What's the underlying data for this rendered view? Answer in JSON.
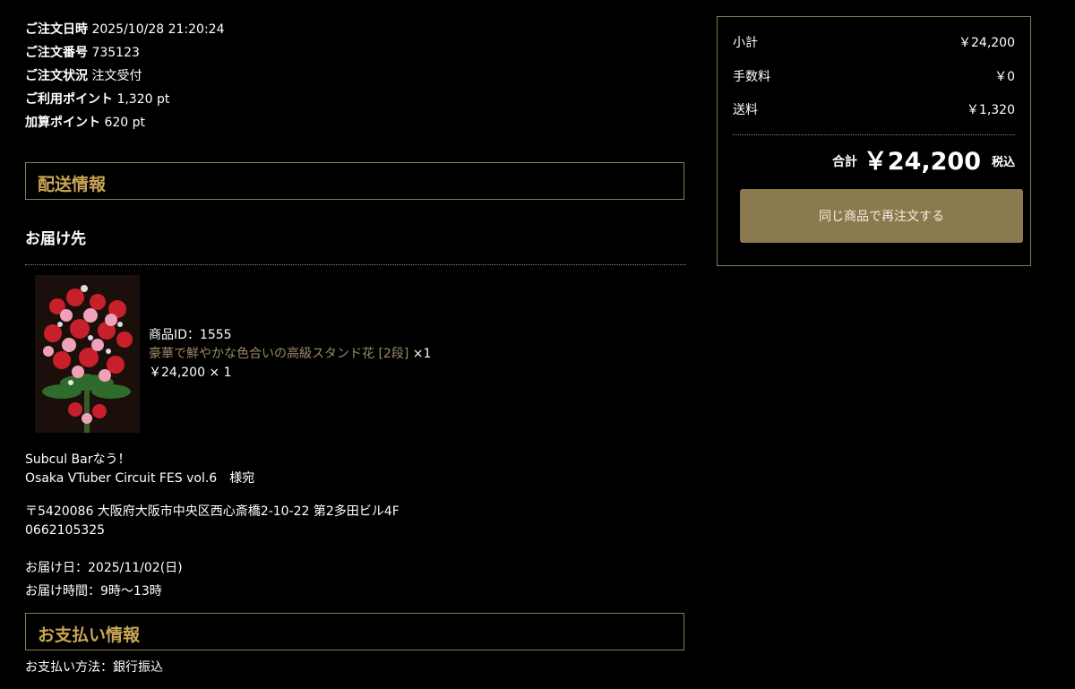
{
  "order": {
    "date_label": "ご注文日時",
    "date_value": "2025/10/28 21:20:24",
    "number_label": "ご注文番号",
    "number_value": "735123",
    "status_label": "ご注文状況",
    "status_value": "注文受付",
    "used_points_label": "ご利用ポイント",
    "used_points_value": "1,320 pt",
    "added_points_label": "加算ポイント",
    "added_points_value": "620 pt"
  },
  "shipping": {
    "section_title": "配送情報",
    "destination_title": "お届け先",
    "product": {
      "id_text": "商品ID：1555",
      "name": "豪華で鮮やかな色合いの高級スタンド花 [2段]",
      "qty_suffix": "×1",
      "price_line": "￥24,200 × 1"
    },
    "recipient_line1": "Subcul Barなう！",
    "recipient_line2": "Osaka VTuber Circuit FES vol.6　様宛",
    "address_line": "〒5420086 大阪府大阪市中央区西心斎橋2-10-22 第2多田ビル4F",
    "phone": "0662105325",
    "delivery_date": "お届け日：2025/11/02(日)",
    "delivery_time": "お届け時間：9時〜13時"
  },
  "payment": {
    "section_title": "お支払い情報",
    "method": "お支払い方法：銀行振込"
  },
  "summary": {
    "subtotal_label": "小計",
    "subtotal_value": "￥24,200",
    "fee_label": "手数料",
    "fee_value": "￥0",
    "shipping_label": "送料",
    "shipping_value": "￥1,320",
    "total_label": "合計",
    "total_value": "￥24,200",
    "tax_label": "税込",
    "reorder_label": "同じ商品で再注文する"
  },
  "colors": {
    "accent_gold": "#c9a455",
    "button_bg": "#8c7a4f",
    "border": "#8a7a55"
  }
}
